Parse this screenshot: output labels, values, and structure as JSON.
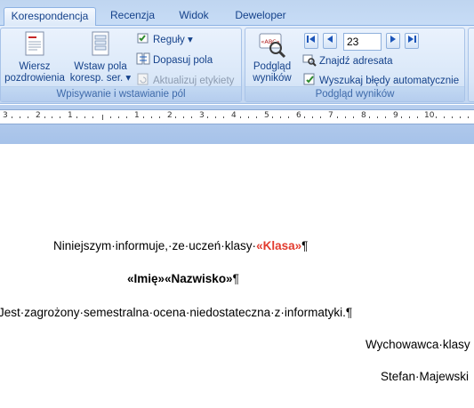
{
  "tabs": [
    {
      "label": "Korespondencja",
      "active": true
    },
    {
      "label": "Recenzja",
      "active": false
    },
    {
      "label": "Widok",
      "active": false
    },
    {
      "label": "Deweloper",
      "active": false
    }
  ],
  "group1": {
    "label": "Wpisywanie i wstawianie pól",
    "greeting_line1": "Wiersz",
    "greeting_line2": "pozdrowienia",
    "insert_field_line1": "Wstaw pola",
    "insert_field_line2": "koresp. ser. ▾",
    "rules": "Reguły ▾",
    "match_fields": "Dopasuj pola",
    "update_labels": "Aktualizuj etykiety"
  },
  "group2": {
    "label": "Podgląd wyników",
    "preview_line1": "Podgląd",
    "preview_line2": "wyników",
    "record_number": "23",
    "find_recipient": "Znajdź adresata",
    "auto_check_errors": "Wyszukaj błędy automatycznie",
    "preview_icon_text": "«ABC»"
  },
  "ruler": {
    "numbers": [
      "3",
      "2",
      "1",
      "1",
      "2",
      "3",
      "4",
      "5",
      "6",
      "7",
      "8",
      "9",
      "10"
    ]
  },
  "document": {
    "line1_text": "Niniejszym·informuje,·ze·uczeń·klasy·",
    "line1_field": "«Klasa»",
    "line1_end": "¶",
    "line2_field1": "«Imię»",
    "line2_field2": "«Nazwisko»",
    "line2_end": "¶",
    "line3_text": "Jest·zagrożony·semestralna·ocena·niedostateczna·z·informatyki.¶",
    "line4_text": "Wychowawca·klasy",
    "line5_text": "Stefan·Majewski"
  },
  "colors": {
    "ribbon_text": "#15428b",
    "merge_field_red": "#e23b2e"
  }
}
